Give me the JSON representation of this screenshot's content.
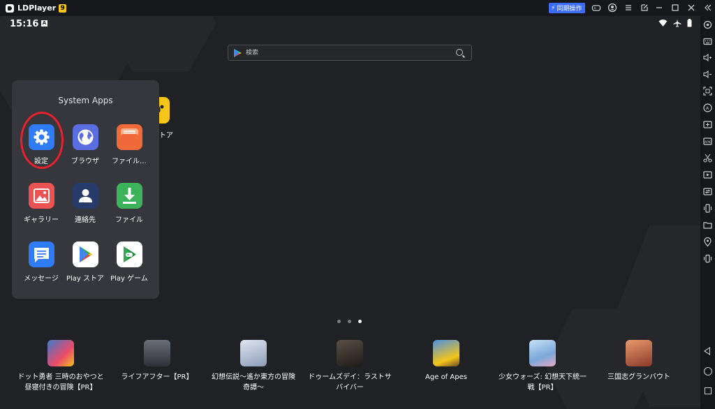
{
  "titlebar": {
    "app_name": "LDPlayer",
    "version_badge": "9",
    "sync_button": "同期操作",
    "icons": [
      "gamepad-icon",
      "user-icon",
      "menu-icon",
      "export-icon",
      "minimize-icon",
      "maximize-icon",
      "close-icon",
      "collapse-icon"
    ]
  },
  "status": {
    "time": "15:16",
    "notification_badge": "A",
    "icons": [
      "wifi-icon",
      "airplane-icon",
      "battery-icon"
    ]
  },
  "search": {
    "placeholder": "検索"
  },
  "partial_app": {
    "label": "トア"
  },
  "folder": {
    "title": "System Apps",
    "apps": [
      {
        "label": "設定",
        "icon": "gear-icon",
        "color": "#2f7cf6"
      },
      {
        "label": "ブラウザ",
        "icon": "globe-icon",
        "color": "#5b6ee1"
      },
      {
        "label": "ファイル…",
        "icon": "file-manager-icon",
        "color": "#f06a3a"
      },
      {
        "label": "ギャラリー",
        "icon": "gallery-icon",
        "color": "#ec5252"
      },
      {
        "label": "連絡先",
        "icon": "contacts-icon",
        "color": "#263b6a"
      },
      {
        "label": "ファイル",
        "icon": "download-icon",
        "color": "#3cb25a"
      },
      {
        "label": "メッセージ",
        "icon": "message-icon",
        "color": "#2f7cf6"
      },
      {
        "label": "Play ストア",
        "icon": "play-store-icon",
        "color": "#ffffff"
      },
      {
        "label": "Play ゲーム",
        "icon": "play-games-icon",
        "color": "#ffffff"
      }
    ]
  },
  "pager": {
    "pages": 3,
    "active": 3
  },
  "recommended": [
    {
      "line1": "ドット勇者 三時のおやつと",
      "line2": "昼寝付きの冒険【PR】",
      "color": "#3d7ac9"
    },
    {
      "line1": "ライフアフター【PR】",
      "line2": "",
      "color": "#4a4d55"
    },
    {
      "line1": "幻想伝説～遙か東方の冒険",
      "line2": "奇譚～",
      "color": "#b8c4d8"
    },
    {
      "line1": "ドゥームズデイ：ラストサ",
      "line2": "バイバー",
      "color": "#3a3530"
    },
    {
      "line1": "Age of Apes",
      "line2": "",
      "color": "#3f7fd6"
    },
    {
      "line1": "少女ウォーズ: 幻想天下統一",
      "line2": "戦【PR】",
      "color": "#9fc6ea"
    },
    {
      "line1": "三国志グランバウト",
      "line2": "",
      "color": "#b8553a"
    }
  ],
  "sidebar_icons": [
    "settings-icon",
    "keyboard-icon",
    "volume-up-icon",
    "volume-down-icon",
    "screenshot-icon",
    "auto-icon",
    "add-app-icon",
    "apk-icon",
    "scissors-icon",
    "record-icon",
    "sync-icon",
    "shake-icon",
    "folder-icon",
    "location-icon",
    "rotate-icon"
  ],
  "nav_icons": [
    "back-icon",
    "home-icon",
    "recent-apps-icon"
  ]
}
